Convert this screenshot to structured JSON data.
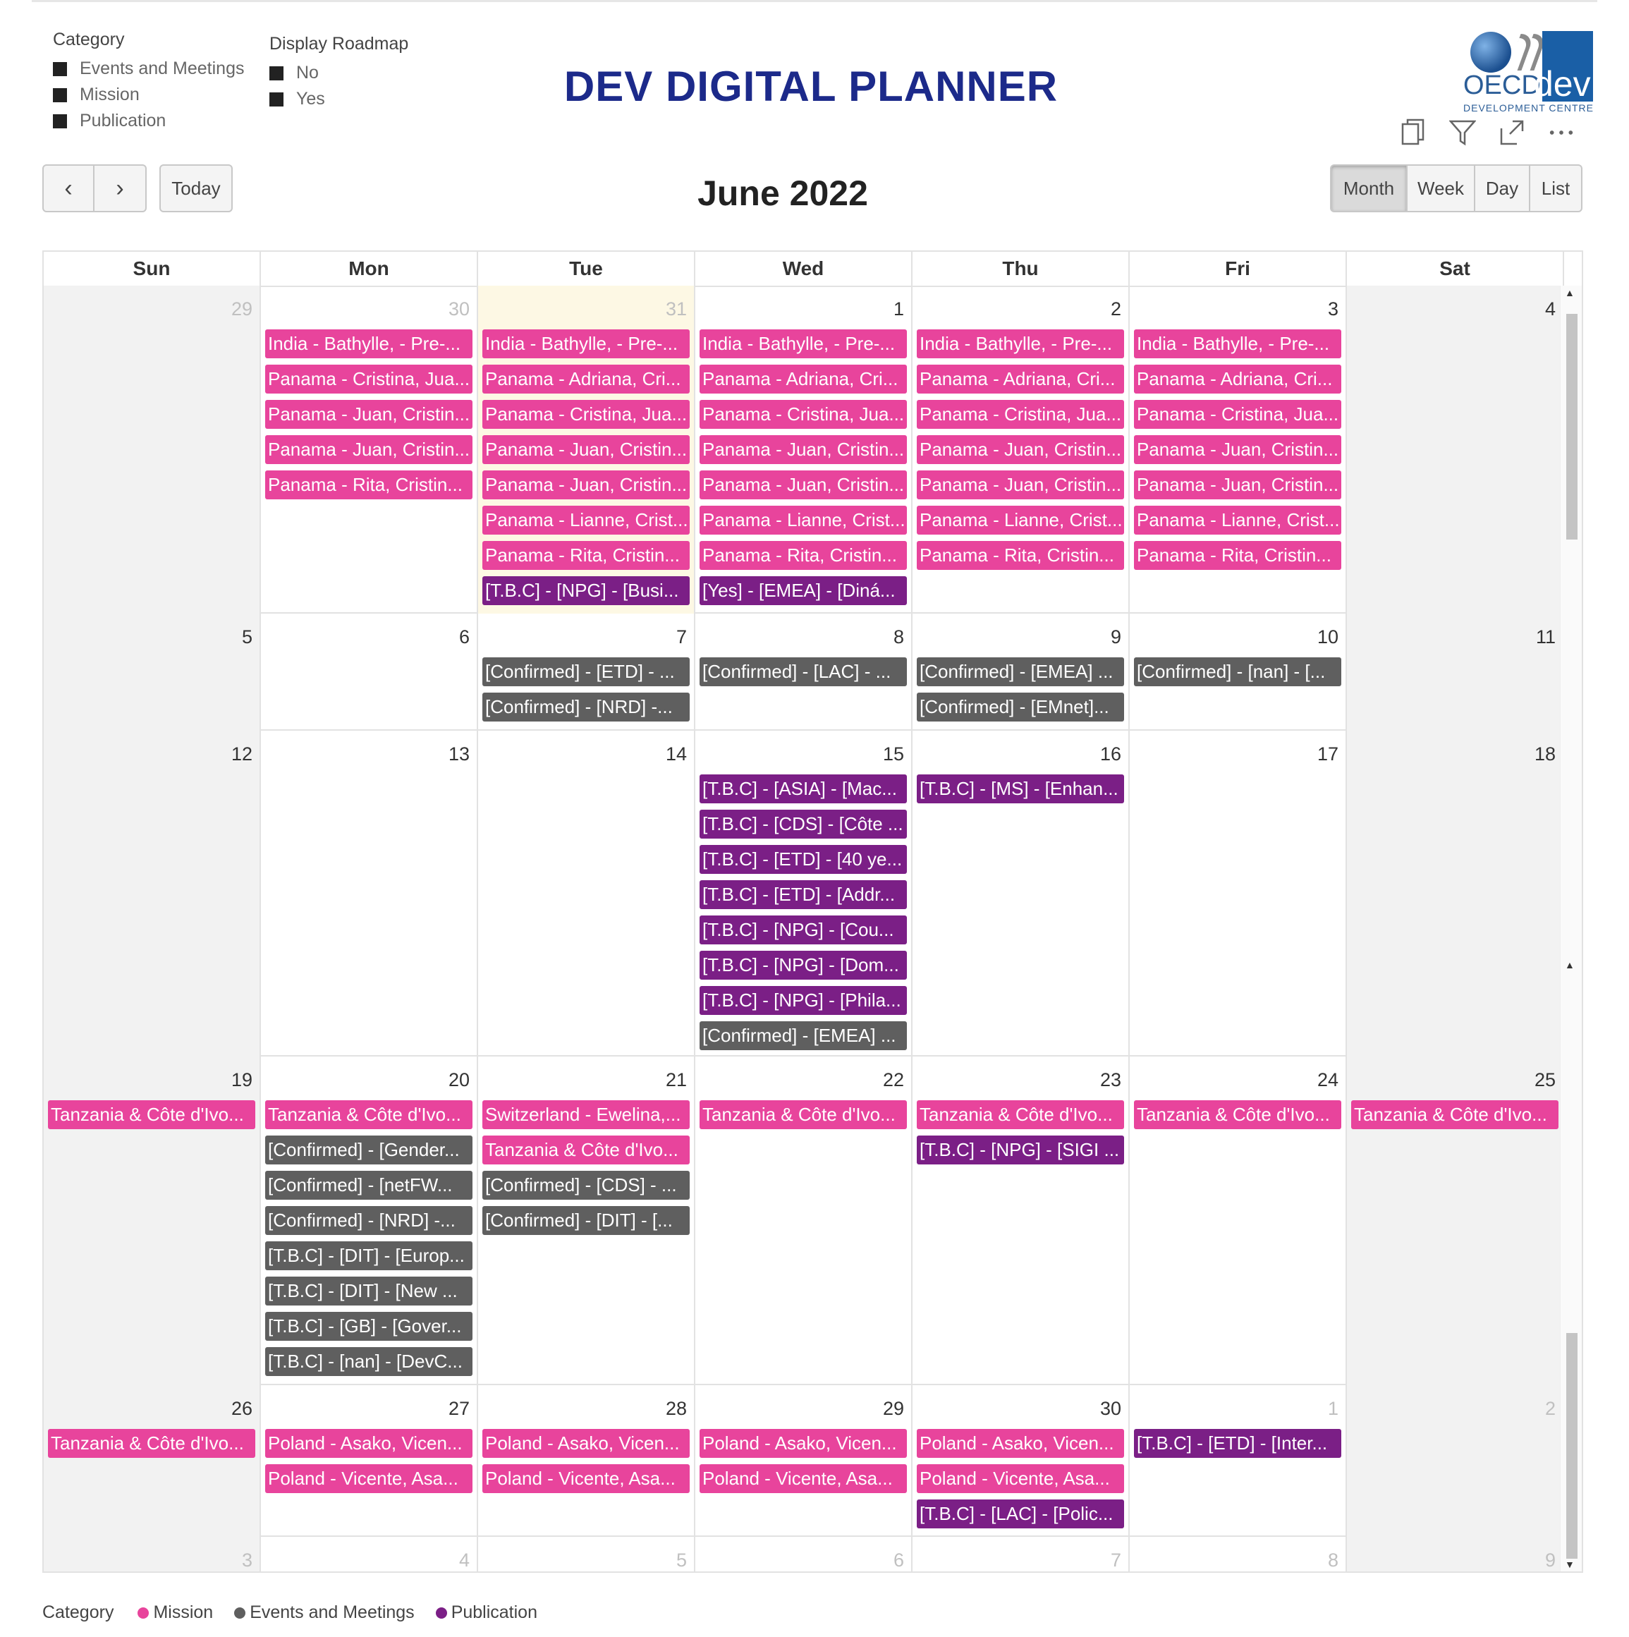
{
  "slicers": {
    "category": {
      "title": "Category",
      "options": [
        "Events and Meetings",
        "Mission",
        "Publication"
      ]
    },
    "roadmap": {
      "title": "Display Roadmap",
      "options": [
        "No",
        "Yes"
      ]
    }
  },
  "page_title": "DEV DIGITAL PLANNER",
  "logo": {
    "oecd": "OECD",
    "dev": "dev",
    "sub": "DEVELOPMENT CENTRE"
  },
  "visual_icons": [
    "copy-icon",
    "filter-icon",
    "focus-mode-icon",
    "more-options-icon"
  ],
  "toolbar": {
    "prev": "‹",
    "next": "›",
    "today": "Today",
    "month_title": "June 2022",
    "views": [
      "Month",
      "Week",
      "Day",
      "List"
    ],
    "active_view": "Month"
  },
  "weekdays": [
    "Sun",
    "Mon",
    "Tue",
    "Wed",
    "Thu",
    "Fri",
    "Sat"
  ],
  "colors": {
    "mission": "#e8449c",
    "meeting": "#5f5f5f",
    "publication": "#7b1f86"
  },
  "weeks": [
    {
      "days": [
        {
          "num": "29",
          "other": true,
          "events": []
        },
        {
          "num": "30",
          "other": true,
          "events": [
            {
              "t": "India - Bathylle, - Pre-...",
              "c": "mission"
            },
            {
              "t": "Panama - Cristina, Jua...",
              "c": "mission"
            },
            {
              "t": "Panama - Juan, Cristin...",
              "c": "mission"
            },
            {
              "t": "Panama - Juan, Cristin...",
              "c": "mission"
            },
            {
              "t": "Panama - Rita, Cristin...",
              "c": "mission"
            }
          ]
        },
        {
          "num": "31",
          "other": true,
          "today": true,
          "events": [
            {
              "t": "India - Bathylle, - Pre-...",
              "c": "mission"
            },
            {
              "t": "Panama - Adriana, Cri...",
              "c": "mission"
            },
            {
              "t": "Panama - Cristina, Jua...",
              "c": "mission"
            },
            {
              "t": "Panama - Juan, Cristin...",
              "c": "mission"
            },
            {
              "t": "Panama - Juan, Cristin...",
              "c": "mission"
            },
            {
              "t": "Panama - Lianne, Crist...",
              "c": "mission"
            },
            {
              "t": "Panama - Rita, Cristin...",
              "c": "mission"
            },
            {
              "t": "[T.B.C] - [NPG] - [Busi...",
              "c": "pub"
            }
          ]
        },
        {
          "num": "1",
          "events": [
            {
              "t": "India - Bathylle, - Pre-...",
              "c": "mission"
            },
            {
              "t": "Panama - Adriana, Cri...",
              "c": "mission"
            },
            {
              "t": "Panama - Cristina, Jua...",
              "c": "mission"
            },
            {
              "t": "Panama - Juan, Cristin...",
              "c": "mission"
            },
            {
              "t": "Panama - Juan, Cristin...",
              "c": "mission"
            },
            {
              "t": "Panama - Lianne, Crist...",
              "c": "mission"
            },
            {
              "t": "Panama - Rita, Cristin...",
              "c": "mission"
            },
            {
              "t": "[Yes] - [EMEA] - [Diná...",
              "c": "pub"
            }
          ]
        },
        {
          "num": "2",
          "events": [
            {
              "t": "India - Bathylle, - Pre-...",
              "c": "mission"
            },
            {
              "t": "Panama - Adriana, Cri...",
              "c": "mission"
            },
            {
              "t": "Panama - Cristina, Jua...",
              "c": "mission"
            },
            {
              "t": "Panama - Juan, Cristin...",
              "c": "mission"
            },
            {
              "t": "Panama - Juan, Cristin...",
              "c": "mission"
            },
            {
              "t": "Panama - Lianne, Crist...",
              "c": "mission"
            },
            {
              "t": "Panama - Rita, Cristin...",
              "c": "mission"
            }
          ]
        },
        {
          "num": "3",
          "events": [
            {
              "t": "India - Bathylle, - Pre-...",
              "c": "mission"
            },
            {
              "t": "Panama - Adriana, Cri...",
              "c": "mission"
            },
            {
              "t": "Panama - Cristina, Jua...",
              "c": "mission"
            },
            {
              "t": "Panama - Juan, Cristin...",
              "c": "mission"
            },
            {
              "t": "Panama - Juan, Cristin...",
              "c": "mission"
            },
            {
              "t": "Panama - Lianne, Crist...",
              "c": "mission"
            },
            {
              "t": "Panama - Rita, Cristin...",
              "c": "mission"
            }
          ]
        },
        {
          "num": "4",
          "events": []
        }
      ]
    },
    {
      "days": [
        {
          "num": "5",
          "events": []
        },
        {
          "num": "6",
          "events": []
        },
        {
          "num": "7",
          "events": [
            {
              "t": "[Confirmed] - [ETD] - ...",
              "c": "meeting"
            },
            {
              "t": "[Confirmed] - [NRD] -...",
              "c": "meeting"
            }
          ]
        },
        {
          "num": "8",
          "events": [
            {
              "t": "[Confirmed] - [LAC] - ...",
              "c": "meeting"
            }
          ]
        },
        {
          "num": "9",
          "events": [
            {
              "t": "[Confirmed] - [EMEA] ...",
              "c": "meeting"
            },
            {
              "t": "[Confirmed] - [EMnet]...",
              "c": "meeting"
            }
          ]
        },
        {
          "num": "10",
          "events": [
            {
              "t": "[Confirmed] - [nan] - [...",
              "c": "meeting"
            }
          ]
        },
        {
          "num": "11",
          "events": []
        }
      ]
    },
    {
      "days": [
        {
          "num": "12",
          "events": []
        },
        {
          "num": "13",
          "events": []
        },
        {
          "num": "14",
          "events": []
        },
        {
          "num": "15",
          "events": [
            {
              "t": "[T.B.C] - [ASIA] - [Mac...",
              "c": "pub"
            },
            {
              "t": "[T.B.C] - [CDS] - [Côte ...",
              "c": "pub"
            },
            {
              "t": "[T.B.C] - [ETD] - [40 ye...",
              "c": "pub"
            },
            {
              "t": "[T.B.C] - [ETD] - [Addr...",
              "c": "pub"
            },
            {
              "t": "[T.B.C] - [NPG] - [Cou...",
              "c": "pub"
            },
            {
              "t": "[T.B.C] - [NPG] - [Dom...",
              "c": "pub"
            },
            {
              "t": "[T.B.C] - [NPG] - [Phila...",
              "c": "pub"
            },
            {
              "t": "[Confirmed] - [EMEA] ...",
              "c": "meeting"
            }
          ]
        },
        {
          "num": "16",
          "events": [
            {
              "t": "[T.B.C] - [MS] - [Enhan...",
              "c": "pub"
            }
          ]
        },
        {
          "num": "17",
          "events": []
        },
        {
          "num": "18",
          "events": []
        }
      ]
    },
    {
      "days": [
        {
          "num": "19",
          "events": [
            {
              "t": "Tanzania & Côte d'Ivo...",
              "c": "mission"
            }
          ]
        },
        {
          "num": "20",
          "events": [
            {
              "t": "Tanzania & Côte d'Ivo...",
              "c": "mission"
            },
            {
              "t": "[Confirmed] - [Gender...",
              "c": "meeting"
            },
            {
              "t": "[Confirmed] - [netFW...",
              "c": "meeting"
            },
            {
              "t": "[Confirmed] - [NRD] -...",
              "c": "meeting"
            },
            {
              "t": "[T.B.C] - [DIT] - [Europ...",
              "c": "meeting"
            },
            {
              "t": "[T.B.C] - [DIT] - [New ...",
              "c": "meeting"
            },
            {
              "t": "[T.B.C] - [GB] - [Gover...",
              "c": "meeting"
            },
            {
              "t": "[T.B.C] - [nan] - [DevC...",
              "c": "meeting"
            }
          ]
        },
        {
          "num": "21",
          "events": [
            {
              "t": "Switzerland - Ewelina,...",
              "c": "mission"
            },
            {
              "t": "Tanzania & Côte d'Ivo...",
              "c": "mission"
            },
            {
              "t": "[Confirmed] - [CDS] - ...",
              "c": "meeting"
            },
            {
              "t": "[Confirmed] - [DIT] - [...",
              "c": "meeting"
            }
          ]
        },
        {
          "num": "22",
          "events": [
            {
              "t": "Tanzania & Côte d'Ivo...",
              "c": "mission"
            }
          ]
        },
        {
          "num": "23",
          "events": [
            {
              "t": "Tanzania & Côte d'Ivo...",
              "c": "mission"
            },
            {
              "t": "[T.B.C] - [NPG] - [SIGI ...",
              "c": "pub"
            }
          ]
        },
        {
          "num": "24",
          "events": [
            {
              "t": "Tanzania & Côte d'Ivo...",
              "c": "mission"
            }
          ]
        },
        {
          "num": "25",
          "events": [
            {
              "t": "Tanzania & Côte d'Ivo...",
              "c": "mission"
            }
          ]
        }
      ]
    },
    {
      "days": [
        {
          "num": "26",
          "events": [
            {
              "t": "Tanzania & Côte d'Ivo...",
              "c": "mission"
            }
          ]
        },
        {
          "num": "27",
          "events": [
            {
              "t": "Poland - Asako, Vicen...",
              "c": "mission"
            },
            {
              "t": "Poland - Vicente, Asa...",
              "c": "mission"
            }
          ]
        },
        {
          "num": "28",
          "events": [
            {
              "t": "Poland - Asako, Vicen...",
              "c": "mission"
            },
            {
              "t": "Poland - Vicente, Asa...",
              "c": "mission"
            }
          ]
        },
        {
          "num": "29",
          "events": [
            {
              "t": "Poland - Asako, Vicen...",
              "c": "mission"
            },
            {
              "t": "Poland - Vicente, Asa...",
              "c": "mission"
            }
          ]
        },
        {
          "num": "30",
          "events": [
            {
              "t": "Poland - Asako, Vicen...",
              "c": "mission"
            },
            {
              "t": "Poland - Vicente, Asa...",
              "c": "mission"
            },
            {
              "t": "[T.B.C] - [LAC] - [Polic...",
              "c": "pub"
            }
          ]
        },
        {
          "num": "1",
          "other": true,
          "events": [
            {
              "t": "[T.B.C] - [ETD] - [Inter...",
              "c": "pub"
            }
          ]
        },
        {
          "num": "2",
          "other": true,
          "events": []
        }
      ]
    },
    {
      "days": [
        {
          "num": "3",
          "other": true,
          "events": []
        },
        {
          "num": "4",
          "other": true,
          "events": []
        },
        {
          "num": "5",
          "other": true,
          "events": []
        },
        {
          "num": "6",
          "other": true,
          "events": []
        },
        {
          "num": "7",
          "other": true,
          "events": []
        },
        {
          "num": "8",
          "other": true,
          "events": []
        },
        {
          "num": "9",
          "other": true,
          "events": []
        }
      ]
    }
  ],
  "legend": {
    "label": "Category",
    "items": [
      {
        "name": "Mission",
        "c": "mission"
      },
      {
        "name": "Events and Meetings",
        "c": "meeting"
      },
      {
        "name": "Publication",
        "c": "publication"
      }
    ]
  }
}
